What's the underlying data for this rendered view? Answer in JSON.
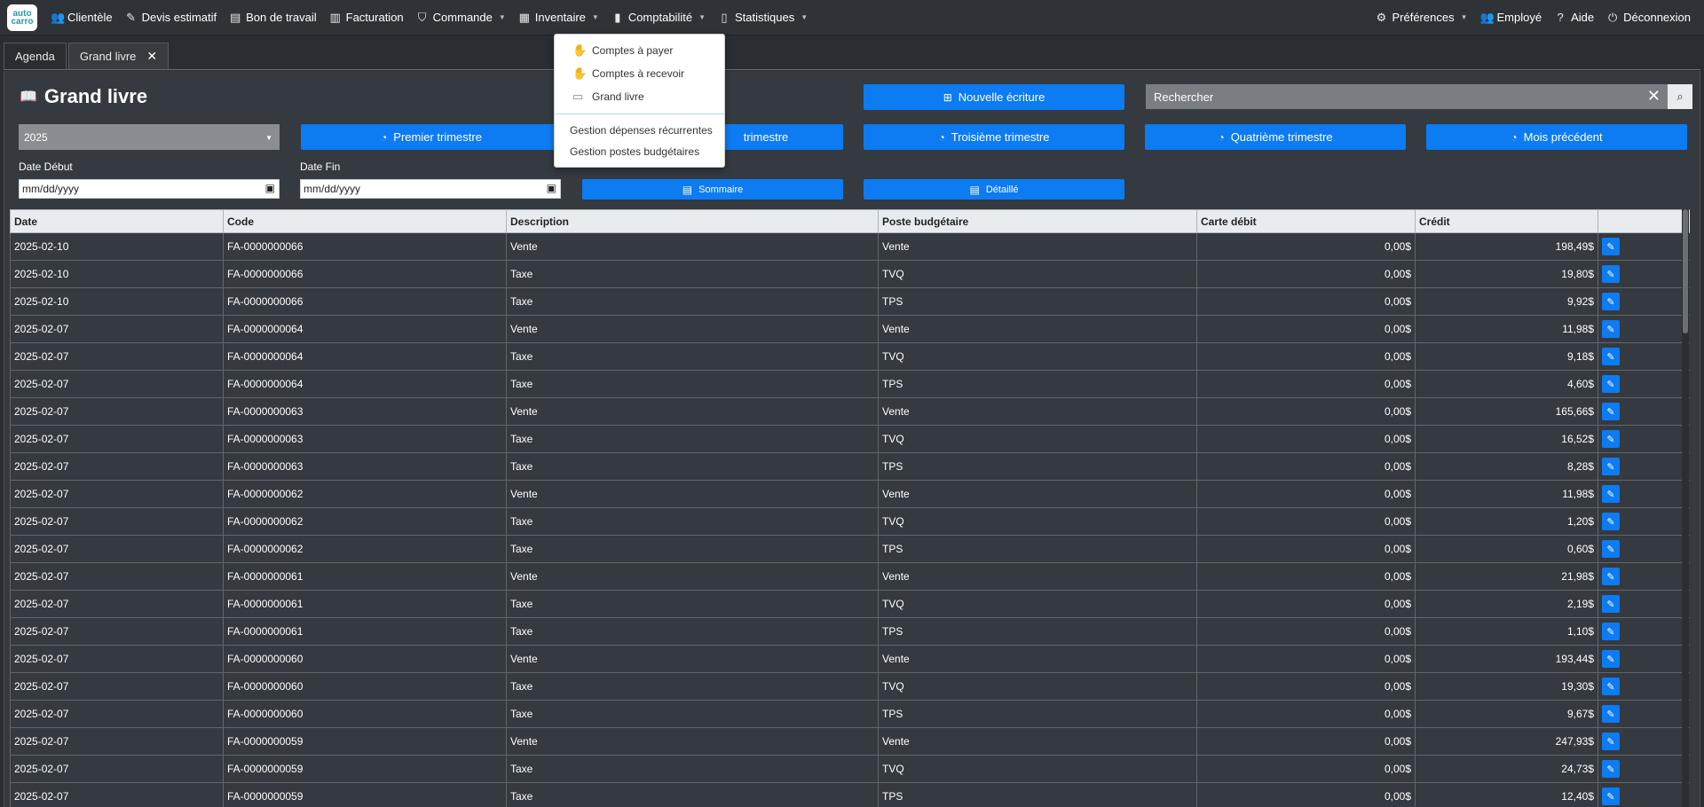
{
  "nav": {
    "logo_top": "auto",
    "logo_bottom": "carro",
    "items": [
      {
        "label": "Clientèle",
        "icon": "users-icon",
        "glyph": "👥"
      },
      {
        "label": "Devis estimatif",
        "icon": "edit-icon",
        "glyph": "✎"
      },
      {
        "label": "Bon de travail",
        "icon": "clipboard-icon",
        "glyph": "▤"
      },
      {
        "label": "Facturation",
        "icon": "document-icon",
        "glyph": "▥"
      },
      {
        "label": "Commande",
        "icon": "basket-icon",
        "glyph": "🧺"
      },
      {
        "label": "Inventaire",
        "icon": "table-icon",
        "glyph": "▦"
      },
      {
        "label": "Comptabilité",
        "icon": "bar-chart-icon",
        "glyph": "▮"
      },
      {
        "label": "Statistiques",
        "icon": "chart-icon",
        "glyph": "▯"
      }
    ],
    "right": {
      "preferences": "Préférences",
      "employee": "Employé",
      "help": "Aide",
      "logout": "Déconnexion"
    }
  },
  "tabs": [
    {
      "label": "Agenda"
    },
    {
      "label": "Grand livre"
    }
  ],
  "page": {
    "title": "Grand livre",
    "new_entry": "Nouvelle écriture",
    "search_placeholder": "Rechercher",
    "year": "2025",
    "quarters": {
      "q1": "Premier trimestre",
      "q2": "trimestre",
      "q3": "Troisième trimestre",
      "q4": "Quatrième trimestre",
      "prev_month": "Mois précédent"
    },
    "date_start_label": "Date Début",
    "date_end_label": "Date Fin",
    "date_placeholder": "mm/dd/yyyy",
    "summary": "Sommaire",
    "detailed": "Détaillé"
  },
  "dropdown": {
    "items": [
      "Comptes à payer",
      "Comptes à recevoir",
      "Grand livre",
      "Gestion dépenses récurrentes",
      "Gestion postes budgétaires"
    ]
  },
  "table": {
    "columns": [
      "Date",
      "Code",
      "Description",
      "Poste budgétaire",
      "Carte débit",
      "Crédit",
      ""
    ],
    "rows": [
      [
        "2025-02-10",
        "FA-0000000066",
        "Vente",
        "Vente",
        "0,00$",
        "198,49$"
      ],
      [
        "2025-02-10",
        "FA-0000000066",
        "Taxe",
        "TVQ",
        "0,00$",
        "19,80$"
      ],
      [
        "2025-02-10",
        "FA-0000000066",
        "Taxe",
        "TPS",
        "0,00$",
        "9,92$"
      ],
      [
        "2025-02-07",
        "FA-0000000064",
        "Vente",
        "Vente",
        "0,00$",
        "11,98$"
      ],
      [
        "2025-02-07",
        "FA-0000000064",
        "Taxe",
        "TVQ",
        "0,00$",
        "9,18$"
      ],
      [
        "2025-02-07",
        "FA-0000000064",
        "Taxe",
        "TPS",
        "0,00$",
        "4,60$"
      ],
      [
        "2025-02-07",
        "FA-0000000063",
        "Vente",
        "Vente",
        "0,00$",
        "165,66$"
      ],
      [
        "2025-02-07",
        "FA-0000000063",
        "Taxe",
        "TVQ",
        "0,00$",
        "16,52$"
      ],
      [
        "2025-02-07",
        "FA-0000000063",
        "Taxe",
        "TPS",
        "0,00$",
        "8,28$"
      ],
      [
        "2025-02-07",
        "FA-0000000062",
        "Vente",
        "Vente",
        "0,00$",
        "11,98$"
      ],
      [
        "2025-02-07",
        "FA-0000000062",
        "Taxe",
        "TVQ",
        "0,00$",
        "1,20$"
      ],
      [
        "2025-02-07",
        "FA-0000000062",
        "Taxe",
        "TPS",
        "0,00$",
        "0,60$"
      ],
      [
        "2025-02-07",
        "FA-0000000061",
        "Vente",
        "Vente",
        "0,00$",
        "21,98$"
      ],
      [
        "2025-02-07",
        "FA-0000000061",
        "Taxe",
        "TVQ",
        "0,00$",
        "2,19$"
      ],
      [
        "2025-02-07",
        "FA-0000000061",
        "Taxe",
        "TPS",
        "0,00$",
        "1,10$"
      ],
      [
        "2025-02-07",
        "FA-0000000060",
        "Vente",
        "Vente",
        "0,00$",
        "193,44$"
      ],
      [
        "2025-02-07",
        "FA-0000000060",
        "Taxe",
        "TVQ",
        "0,00$",
        "19,30$"
      ],
      [
        "2025-02-07",
        "FA-0000000060",
        "Taxe",
        "TPS",
        "0,00$",
        "9,67$"
      ],
      [
        "2025-02-07",
        "FA-0000000059",
        "Vente",
        "Vente",
        "0,00$",
        "247,93$"
      ],
      [
        "2025-02-07",
        "FA-0000000059",
        "Taxe",
        "TVQ",
        "0,00$",
        "24,73$"
      ],
      [
        "2025-02-07",
        "FA-0000000059",
        "Taxe",
        "TPS",
        "0,00$",
        "12,40$"
      ]
    ]
  },
  "colors": {
    "accent": "#0d7bf2",
    "panel": "#343a40",
    "danger": "#ff3b30"
  }
}
